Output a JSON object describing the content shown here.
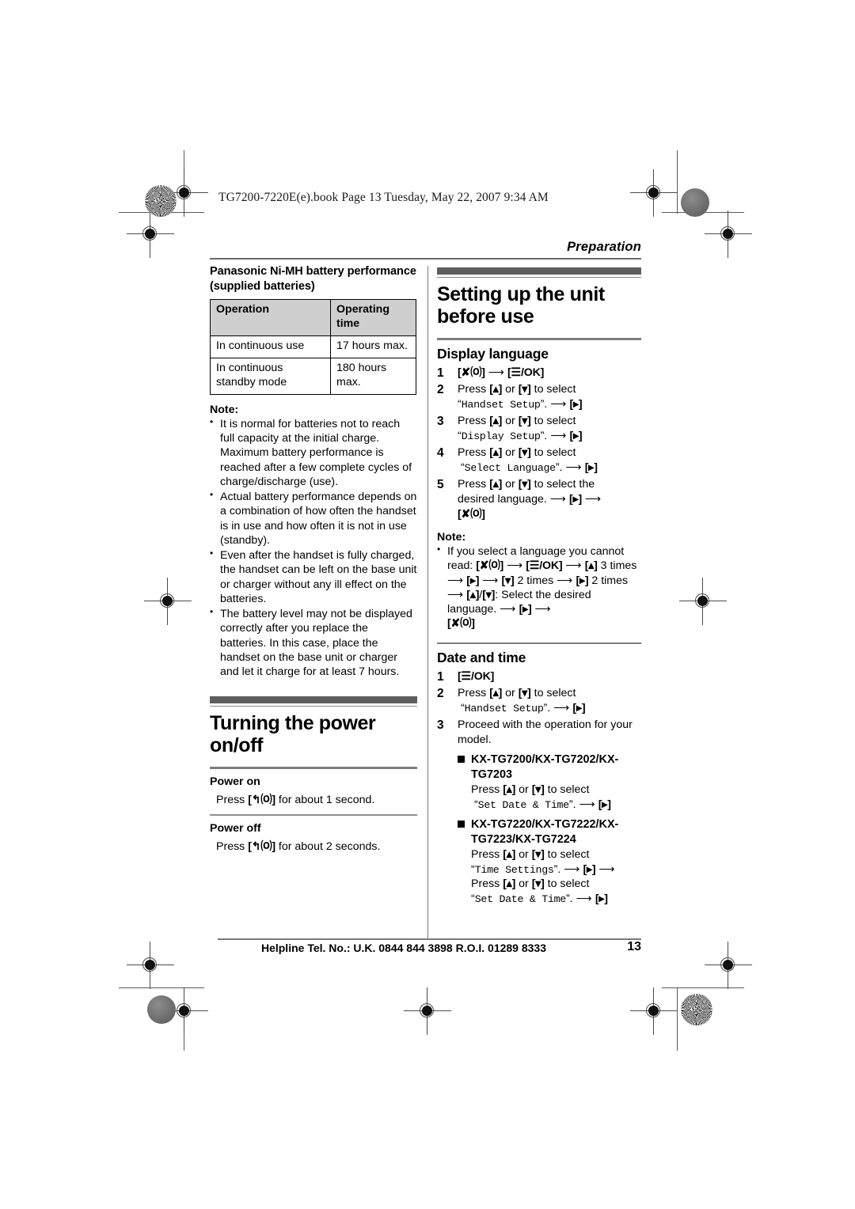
{
  "print_marks": {
    "book_line": "TG7200-7220E(e).book  Page 13  Tuesday, May 22, 2007  9:34 AM"
  },
  "header": {
    "running_head": "Preparation"
  },
  "left_column": {
    "battery_section": {
      "heading": "Panasonic Ni-MH battery performance (supplied batteries)",
      "table": {
        "columns": [
          "Operation",
          "Operating time"
        ],
        "rows": [
          [
            "In continuous use",
            "17 hours max."
          ],
          [
            "In continuous standby mode",
            "180 hours max."
          ]
        ]
      },
      "note_label": "Note:",
      "notes": [
        "It is normal for batteries not to reach full capacity at the initial charge. Maximum battery performance is reached after a few complete cycles of charge/discharge (use).",
        "Actual battery performance depends on a combination of how often the handset is in use and how often it is not in use (standby).",
        "Even after the handset is fully charged, the handset can be left on the base unit or charger without any ill effect on the batteries.",
        "The battery level may not be displayed correctly after you replace the batteries. In this case, place the handset on the base unit or charger and let it charge for at least 7 hours."
      ]
    },
    "power_section": {
      "title": "Turning the power on/off",
      "power_on_label": "Power on",
      "power_on_text_pre": "Press ",
      "power_on_key": "[↰⒪]",
      "power_on_text_post": " for about 1 second.",
      "power_off_label": "Power off",
      "power_off_text_pre": "Press ",
      "power_off_key": "[↰⒪]",
      "power_off_text_post": " for about 2 seconds."
    }
  },
  "right_column": {
    "setup_section": {
      "title": "Setting up the unit before use",
      "display_language": {
        "heading": "Display language",
        "steps": [
          {
            "num": "1",
            "html": "<span class=\"key\">[✘⒪]</span> <span class=\"arr\">⟶</span> <span class=\"key\">[☰/OK]</span>"
          },
          {
            "num": "2",
            "html": "Press <span class=\"key\">[▴]</span> or <span class=\"key\">[▾]</span> to select<br>“<span class=\"mono\">Handset Setup</span>”. <span class=\"arr\">⟶</span> <span class=\"key\">[▸]</span>"
          },
          {
            "num": "3",
            "html": "Press <span class=\"key\">[▴]</span> or <span class=\"key\">[▾]</span> to select<br>“<span class=\"mono\">Display Setup</span>”. <span class=\"arr\">⟶</span> <span class=\"key\">[▸]</span>"
          },
          {
            "num": "4",
            "html": "Press <span class=\"key\">[▴]</span> or <span class=\"key\">[▾]</span> to select<br>&nbsp;“<span class=\"mono\">Select Language</span>”. <span class=\"arr\">⟶</span> <span class=\"key\">[▸]</span>"
          },
          {
            "num": "5",
            "html": "Press <span class=\"key\">[▴]</span> or <span class=\"key\">[▾]</span> to select the<br>desired language. <span class=\"arr\">⟶</span> <span class=\"key\">[▸]</span> <span class=\"arr\">⟶</span><br><span class=\"key\">[✘⒪]</span>"
          }
        ],
        "note_label": "Note:",
        "note_html": "If you select a language you cannot read: <span class=\"key\">[✘⒪]</span> <span class=\"arr\">⟶</span> <span class=\"key\">[☰/OK]</span> <span class=\"arr\">⟶</span> <span class=\"key\">[▴]</span> 3 times <span class=\"arr\">⟶</span> <span class=\"key\">[▸]</span> <span class=\"arr\">⟶</span> <span class=\"key\">[▾]</span> 2 times <span class=\"arr\">⟶</span> <span class=\"key\">[▸]</span> 2 times <span class=\"arr\">⟶</span> <span class=\"key\">[▴]</span>/<span class=\"key\">[▾]</span>: Select the desired language. <span class=\"arr\">⟶</span> <span class=\"key\">[▸]</span> <span class=\"arr\">⟶</span><br><span class=\"key\">[✘⒪]</span>"
      },
      "date_time": {
        "heading": "Date and time",
        "steps": [
          {
            "num": "1",
            "html": "<span class=\"key\">[☰/OK]</span>"
          },
          {
            "num": "2",
            "html": "Press <span class=\"key\">[▴]</span> or <span class=\"key\">[▾]</span> to select<br>&nbsp;“<span class=\"mono\">Handset Setup</span>”. <span class=\"arr\">⟶</span> <span class=\"key\">[▸]</span>"
          },
          {
            "num": "3",
            "html": "Proceed with the operation for your model."
          }
        ],
        "model_groups": [
          {
            "models": "KX-TG7200/KX-TG7202/KX-TG7203",
            "body_html": "Press <span class=\"key\">[▴]</span> or <span class=\"key\">[▾]</span> to select<br>&nbsp;“<span class=\"mono\">Set Date &amp; Time</span>”. <span class=\"arr\">⟶</span> <span class=\"key\">[▸]</span>"
          },
          {
            "models": "KX-TG7220/KX-TG7222/KX-TG7223/KX-TG7224",
            "body_html": "Press <span class=\"key\">[▴]</span> or <span class=\"key\">[▾]</span> to select<br>“<span class=\"mono\">Time Settings</span>”. <span class=\"arr\">⟶</span> <span class=\"key\">[▸]</span> <span class=\"arr\">⟶</span><br>Press <span class=\"key\">[▴]</span> or <span class=\"key\">[▾]</span> to select<br>“<span class=\"mono\">Set Date &amp; Time</span>”. <span class=\"arr\">⟶</span> <span class=\"key\">[▸]</span>"
          }
        ]
      }
    }
  },
  "footer": {
    "helpline": "Helpline Tel. No.: U.K. 0844 844 3898 R.O.I. 01289 8333",
    "page_number": "13"
  }
}
